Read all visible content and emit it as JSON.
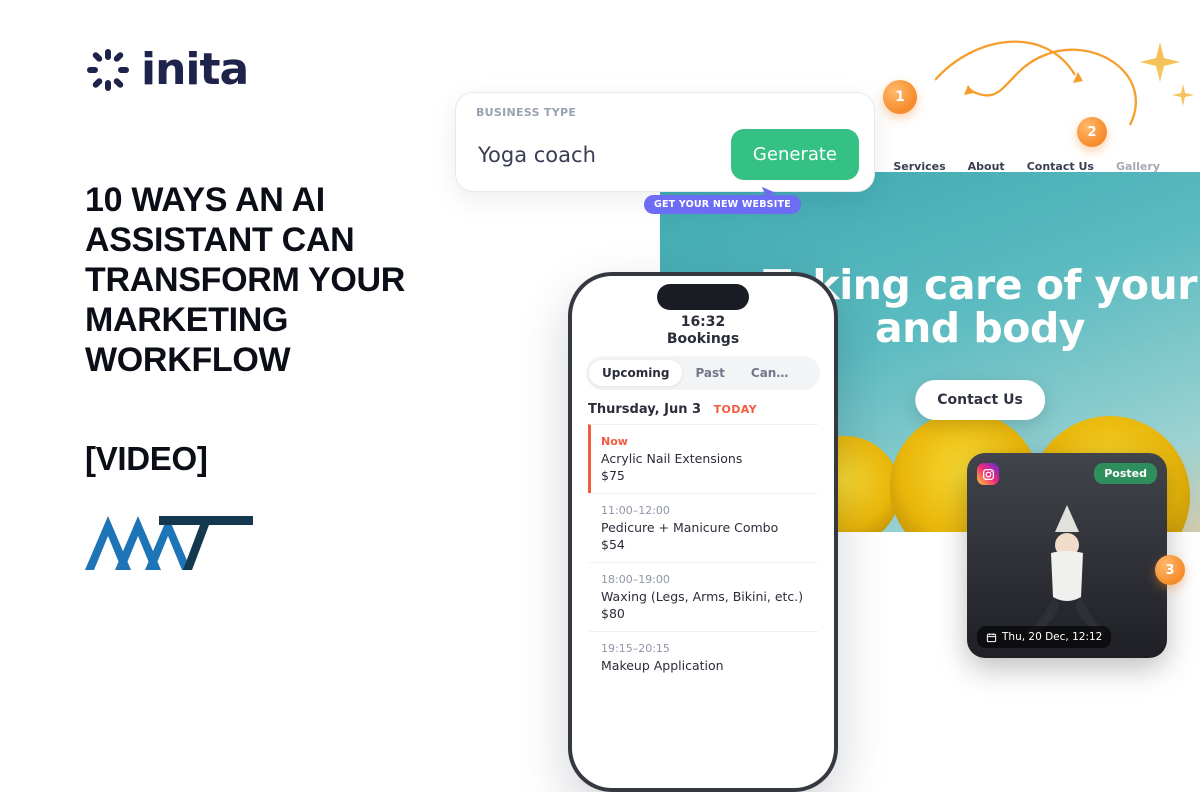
{
  "brand": {
    "name": "inita"
  },
  "headline": "10 WAYS AN AI ASSISTANT CAN TRANSFORM YOUR MARKETING WORKFLOW",
  "video_tag": "[VIDEO]",
  "generator": {
    "label": "BUSINESS TYPE",
    "input_value": "Yoga coach",
    "button": "Generate",
    "pill": "GET YOUR NEW WEBSITE"
  },
  "nav": [
    {
      "label": "Services"
    },
    {
      "label": "About"
    },
    {
      "label": "Contact Us"
    },
    {
      "label": "Gallery"
    }
  ],
  "hero": {
    "title_line1": "Taking care of your",
    "title_line2": "and body",
    "cta": "Contact Us"
  },
  "phone": {
    "time": "16:32",
    "title": "Bookings",
    "tabs": [
      "Upcoming",
      "Past",
      "Can…"
    ],
    "date": "Thursday, Jun 3",
    "today": "TODAY",
    "items": [
      {
        "time": "Now",
        "service": "Acrylic Nail Extensions",
        "price": "$75"
      },
      {
        "time": "11:00–12:00",
        "service": "Pedicure + Manicure Combo",
        "price": "$54"
      },
      {
        "time": "18:00–19:00",
        "service": "Waxing (Legs, Arms, Bikini, etc.)",
        "price": "$80"
      },
      {
        "time": "19:15–20:15",
        "service": "Makeup Application",
        "price": ""
      }
    ]
  },
  "ig_post": {
    "status": "Posted",
    "datetime": "Thu, 20 Dec, 12:12"
  },
  "numbers": [
    "1",
    "2",
    "3"
  ]
}
